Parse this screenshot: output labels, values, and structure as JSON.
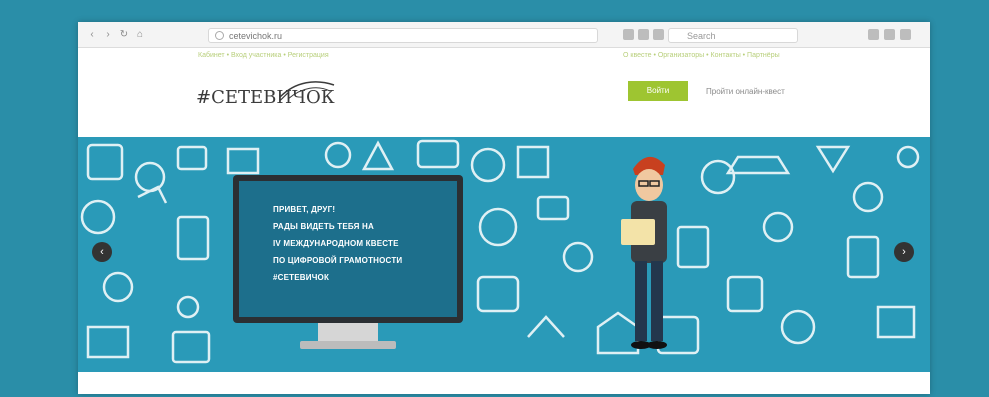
{
  "browser": {
    "address_url": "cetevichok.ru",
    "search_placeholder": "Search"
  },
  "header": {
    "left_links": "Кабинет • Вход участника • Регистрация",
    "right_links": "О квесте • Организаторы • Контакты • Партнёры",
    "logo": "#СЕТЕВИЧОК",
    "login_label": "Войти",
    "link_label": "Пройти онлайн-квест"
  },
  "hero": {
    "lines": [
      "ПРИВЕТ, ДРУГ!",
      "РАДЫ ВИДЕТЬ ТЕБЯ НА",
      "IV МЕЖДУНАРОДНОМ КВЕСТЕ",
      "ПО ЦИФРОВОЙ ГРАМОТНОСТИ",
      "#СЕТЕВИЧОК"
    ],
    "prev_icon": "chevron-left-icon",
    "next_icon": "chevron-right-icon"
  },
  "colors": {
    "background": "#2a8ea8",
    "hero": "#2a9ab8",
    "accent": "#9ec531",
    "screen": "#1d6f8c"
  }
}
